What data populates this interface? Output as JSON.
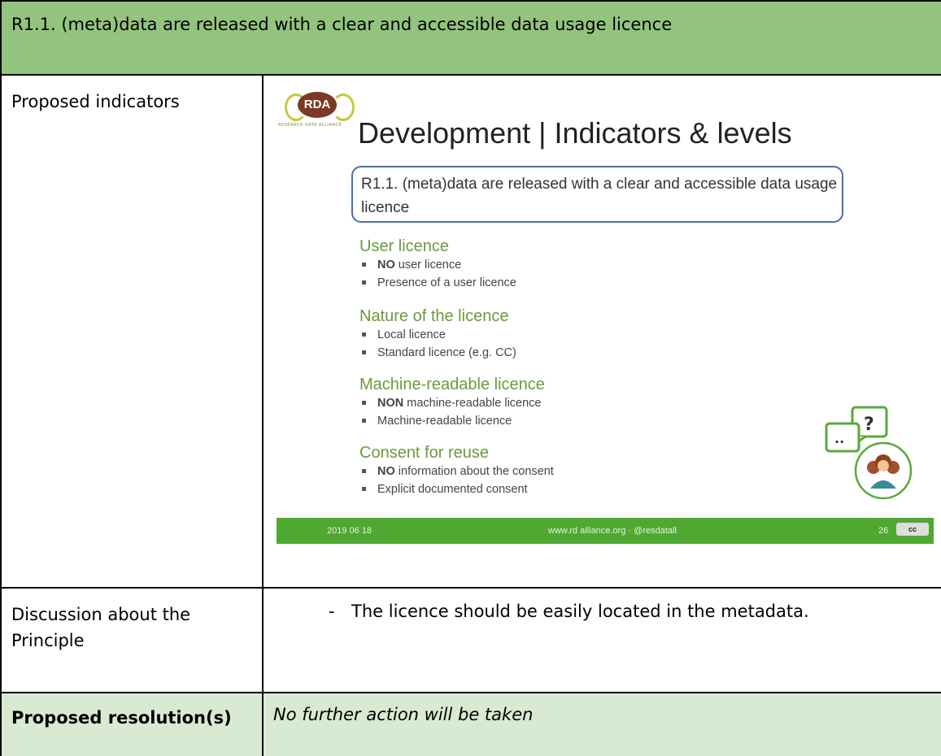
{
  "header": {
    "title": "R1.1. (meta)data are released with a clear and accessible data usage licence"
  },
  "rows": {
    "indicators_label": "Proposed indicators",
    "discussion_label": "Discussion about the Principle",
    "discussion_items": [
      "The licence should be easily located in the metadata."
    ],
    "discussion_dash": "-",
    "resolution_label": "Proposed resolution(s)",
    "resolution_value": "No further action will be taken"
  },
  "slide": {
    "logo_text": "RDA",
    "logo_subtitle": "RESEARCH DATA ALLIANCE",
    "title": "Development | Indicators & levels",
    "principle": "R1.1. (meta)data are released with a clear and accessible data usage licence",
    "sections": [
      {
        "heading": "User licence",
        "items": [
          "NO user licence",
          "Presence of a user licence"
        ],
        "bold_prefix": [
          "NO",
          ""
        ]
      },
      {
        "heading": "Nature of the licence",
        "items": [
          "Local licence",
          "Standard licence (e.g. CC)"
        ]
      },
      {
        "heading": "Machine-readable licence",
        "items": [
          "NON machine-readable licence",
          "Machine-readable licence"
        ]
      },
      {
        "heading": "Consent for reuse",
        "items": [
          "NO information about the consent",
          "Explicit documented consent"
        ]
      }
    ],
    "footer": {
      "date": "2019 06 18",
      "site": "www.rd alliance.org · @resdatall",
      "page": "26",
      "cc": "cc"
    }
  },
  "colors": {
    "header_green": "#93c47d",
    "resolution_green": "#d9ead3",
    "slide_bar": "#4fa831",
    "heading_green": "#6a9a3b"
  }
}
